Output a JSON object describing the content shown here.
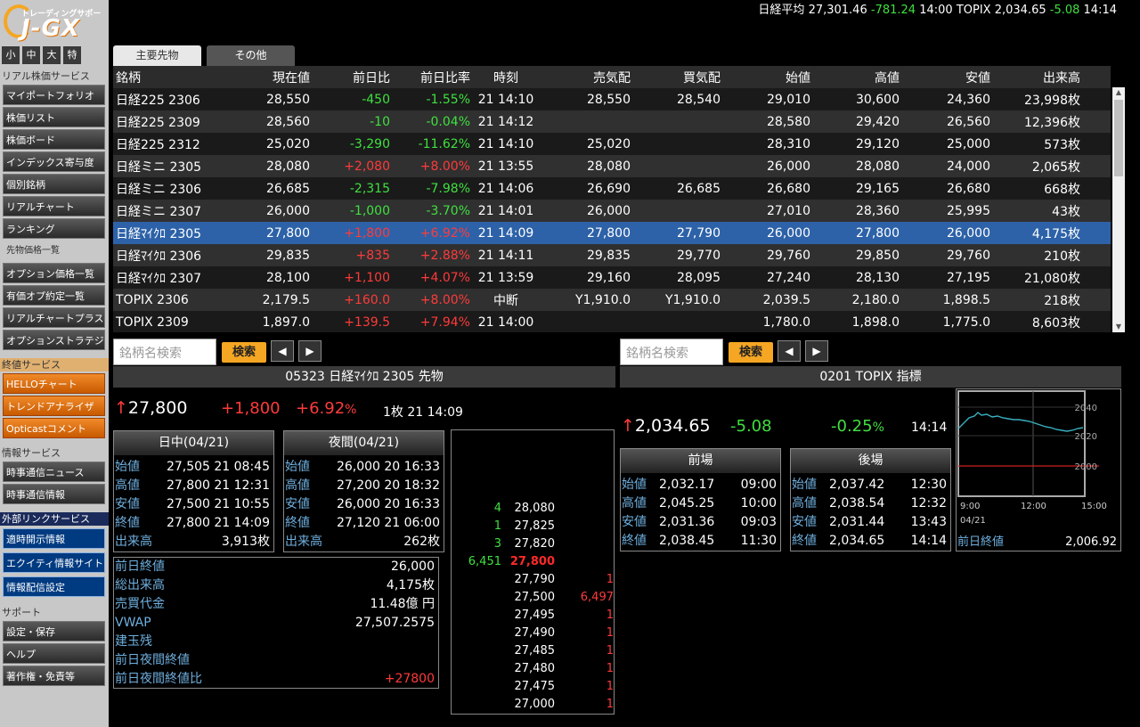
{
  "app": {
    "logo_sub": "トレーディングサポート",
    "logo_main": "J-GX"
  },
  "size_buttons": [
    "小",
    "中",
    "大",
    "特"
  ],
  "sidebar": {
    "sec_realtime": "リアル株価サービス",
    "realtime": [
      "マイポートフォリオ",
      "株価リスト",
      "株価ボード",
      "インデックス寄与度",
      "個別銘柄",
      "リアルチャート",
      "ランキング"
    ],
    "futures_current": "先物価格一覧",
    "realtime2": [
      "オプション価格一覧",
      "有価オプ約定一覧",
      "リアルチャートプラス",
      "オプションストラテジ"
    ],
    "sec_terminal": "終値サービス",
    "terminal": [
      "HELLOチャート",
      "トレンドアナライザ",
      "Opticastコメント"
    ],
    "sec_info": "情報サービス",
    "info": [
      "時事通信ニュース",
      "時事通信情報"
    ],
    "sec_external": "外部リンクサービス",
    "external": [
      "適時開示情報",
      "エクイティ情報サイト",
      "情報配信設定"
    ],
    "sec_support": "サポート",
    "support": [
      "設定・保存",
      "ヘルプ",
      "著作権・免責等"
    ]
  },
  "ticker": {
    "n225_label": "日経平均",
    "n225_value": "27,301.46",
    "n225_change": "-781.24",
    "n225_time": "14:00",
    "topix_label": "TOPIX",
    "topix_value": "2,034.65",
    "topix_change": "-5.08",
    "topix_time": "14:14"
  },
  "tabs": [
    "主要先物",
    "その他"
  ],
  "table": {
    "headers": [
      "銘柄",
      "現在値",
      "前日比",
      "前日比率",
      "時刻",
      "売気配",
      "買気配",
      "始値",
      "高値",
      "安値",
      "出来高"
    ],
    "rows": [
      [
        "日経225 2306",
        "28,550",
        "-450",
        "-1.55%",
        "21 14:10",
        "28,550",
        "28,540",
        "29,010",
        "30,600",
        "24,360",
        "23,998枚"
      ],
      [
        "日経225 2309",
        "28,560",
        "-10",
        "-0.04%",
        "21 14:12",
        "",
        "",
        "28,580",
        "29,420",
        "26,560",
        "12,396枚"
      ],
      [
        "日経225 2312",
        "25,020",
        "-3,290",
        "-11.62%",
        "21 14:10",
        "25,020",
        "",
        "28,310",
        "29,120",
        "25,000",
        "573枚"
      ],
      [
        "日経ミニ 2305",
        "28,080",
        "+2,080",
        "+8.00%",
        "21 13:55",
        "28,080",
        "",
        "26,000",
        "28,080",
        "24,000",
        "2,065枚"
      ],
      [
        "日経ミニ 2306",
        "26,685",
        "-2,315",
        "-7.98%",
        "21 14:06",
        "26,690",
        "26,685",
        "26,680",
        "29,165",
        "26,680",
        "668枚"
      ],
      [
        "日経ミニ 2307",
        "26,000",
        "-1,000",
        "-3.70%",
        "21 14:01",
        "26,000",
        "",
        "27,010",
        "28,360",
        "25,995",
        "43枚"
      ],
      [
        "日経ﾏｲｸﾛ 2305",
        "27,800",
        "+1,800",
        "+6.92%",
        "21 14:09",
        "27,800",
        "27,790",
        "26,000",
        "27,800",
        "26,000",
        "4,175枚"
      ],
      [
        "日経ﾏｲｸﾛ 2306",
        "29,835",
        "+835",
        "+2.88%",
        "21 14:11",
        "29,835",
        "29,770",
        "29,760",
        "29,850",
        "29,760",
        "210枚"
      ],
      [
        "日経ﾏｲｸﾛ 2307",
        "28,100",
        "+1,100",
        "+4.07%",
        "21 13:59",
        "29,160",
        "28,095",
        "27,240",
        "28,130",
        "27,195",
        "21,080枚"
      ],
      [
        "TOPIX 2306",
        "2,179.5",
        "+160.0",
        "+8.00%",
        "中断",
        "Y1,910.0",
        "Y1,910.0",
        "2,039.5",
        "2,180.0",
        "1,898.5",
        "218枚"
      ],
      [
        "TOPIX 2309",
        "1,897.0",
        "+139.5",
        "+7.94%",
        "21 14:00",
        "",
        "",
        "1,780.0",
        "1,898.0",
        "1,775.0",
        "8,603枚"
      ]
    ],
    "selected_row": 6
  },
  "left_panel": {
    "search_placeholder": "銘柄名検索",
    "search_label": "検索",
    "prev": "◀",
    "next": "▶",
    "title": "05323 日経ﾏｲｸﾛ 2305 先物",
    "price_arrow": "↑",
    "price": "27,800",
    "change": "+1,800",
    "pct": "+6.92",
    "pct_unit": "%",
    "volume_time": "1枚 21 14:09",
    "day_title": "日中(04/21)",
    "day": [
      [
        "始値",
        "27,505 21 08:45"
      ],
      [
        "高値",
        "27,800 21 12:31"
      ],
      [
        "安値",
        "27,500 21 10:55"
      ],
      [
        "終値",
        "27,800 21 14:09"
      ],
      [
        "出来高",
        "3,913枚"
      ]
    ],
    "night_title": "夜間(04/21)",
    "night": [
      [
        "始値",
        "26,000 20 16:33"
      ],
      [
        "高値",
        "27,200 20 18:32"
      ],
      [
        "安値",
        "26,000 20 16:33"
      ],
      [
        "終値",
        "27,120 21 06:00"
      ],
      [
        "出来高",
        "262枚"
      ]
    ],
    "stats": [
      [
        "前日終値",
        "26,000"
      ],
      [
        "総出来高",
        "4,175枚"
      ],
      [
        "売買代金",
        "11.48億 円"
      ],
      [
        "VWAP",
        "27,507.2575"
      ],
      [
        "建玉残",
        ""
      ],
      [
        "前日夜間終値",
        ""
      ],
      [
        "前日夜間終値比",
        "+27800"
      ]
    ],
    "depth": [
      [
        "4",
        "28,080",
        ""
      ],
      [
        "1",
        "27,825",
        ""
      ],
      [
        "3",
        "27,820",
        ""
      ],
      [
        "6,451",
        "27,800",
        ""
      ],
      [
        "",
        "27,790",
        "1"
      ],
      [
        "",
        "27,500",
        "6,497"
      ],
      [
        "",
        "27,495",
        "1"
      ],
      [
        "",
        "27,490",
        "1"
      ],
      [
        "",
        "27,485",
        "1"
      ],
      [
        "",
        "27,480",
        "1"
      ],
      [
        "",
        "27,475",
        "1"
      ],
      [
        "",
        "27,000",
        "1"
      ]
    ],
    "depth_current_index": 3
  },
  "right_panel": {
    "search_placeholder": "銘柄名検索",
    "search_label": "検索",
    "prev": "◀",
    "next": "▶",
    "title": "0201 TOPIX 指標",
    "price_arrow": "↑",
    "price": "2,034.65",
    "change": "-5.08",
    "pct": "-0.25",
    "pct_unit": "%",
    "time": "14:14",
    "am_title": "前場",
    "am": [
      [
        "始値",
        "2,032.17",
        "09:00"
      ],
      [
        "高値",
        "2,045.25",
        "10:00"
      ],
      [
        "安値",
        "2,031.36",
        "09:03"
      ],
      [
        "終値",
        "2,038.45",
        "11:30"
      ]
    ],
    "pm_title": "後場",
    "pm": [
      [
        "始値",
        "2,037.42",
        "12:30"
      ],
      [
        "高値",
        "2,038.54",
        "12:32"
      ],
      [
        "安値",
        "2,031.44",
        "13:43"
      ],
      [
        "終値",
        "2,034.65",
        "14:14"
      ]
    ],
    "chart": {
      "y_labels": [
        "2040",
        "2020",
        "2000"
      ],
      "x_labels": [
        "9:00",
        "12:00",
        "15:00"
      ],
      "date": "04/21",
      "prev_close_label": "前日終値",
      "prev_close": "2,006.92"
    }
  },
  "colors": {
    "up": "#ff3a3a",
    "down": "#3fe03f",
    "selected": "#2d62a8",
    "accent": "#f5a623"
  }
}
